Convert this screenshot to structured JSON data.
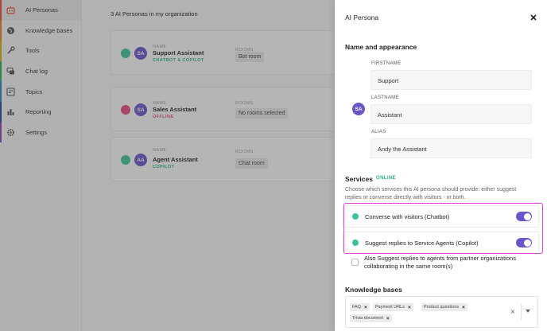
{
  "nav": {
    "items": [
      {
        "label": "AI Personas",
        "icon": "robot-icon",
        "bar_color": "#e74c3c",
        "active": true
      },
      {
        "label": "Knowledge bases",
        "icon": "globe-icon",
        "bar_color": "#e67e22",
        "active": false
      },
      {
        "label": "Tools",
        "icon": "wrench-icon",
        "bar_color": "#d4b000",
        "active": false
      },
      {
        "label": "Chat log",
        "icon": "chat-icon",
        "bar_color": "#27ae60",
        "active": false
      },
      {
        "label": "Topics",
        "icon": "topics-icon",
        "bar_color": "#2980b9",
        "active": false
      },
      {
        "label": "Reporting",
        "icon": "bar-chart-icon",
        "bar_color": "#2c3e9e",
        "active": false
      },
      {
        "label": "Settings",
        "icon": "gear-icon",
        "bar_color": "#8e44ad",
        "active": false
      }
    ]
  },
  "main": {
    "title": "3 AI Personas in my organization",
    "name_label": "NAME",
    "rooms_label": "ROOMS",
    "agents": [
      {
        "initials": "SA",
        "name": "Support Assistant",
        "mode": "CHATBOT & COPILOT",
        "mode_color": "#2cb38f",
        "status_color": "#3ec29b",
        "room": "Bot room"
      },
      {
        "initials": "SA",
        "name": "Sales Assistant",
        "mode": "OFFLINE",
        "mode_color": "#e0507a",
        "status_color": "#e0507a",
        "room": "No rooms selected"
      },
      {
        "initials": "AA",
        "name": "Agent Assistant",
        "mode": "COPILOT",
        "mode_color": "#2cb38f",
        "status_color": "#3ec29b",
        "room": "Chat room"
      }
    ]
  },
  "panel": {
    "title": "AI Persona",
    "name_section": "Name and appearance",
    "avatar_initials": "SA",
    "firstname_label": "FIRSTNAME",
    "firstname_value": "Support",
    "lastname_label": "LASTNAME",
    "lastname_value": "Assistant",
    "alias_label": "ALIAS",
    "alias_value": "Andy the Assistant",
    "services_title": "Services",
    "services_status": "ONLINE",
    "services_desc": "Choose which services this AI persona should provide: either suggest replies or converse directly with visitors - or both.",
    "services": [
      {
        "label": "Converse with visitors (Chatbot)",
        "enabled": true
      },
      {
        "label": "Suggest replies to Service Agents (Copilot)",
        "enabled": true
      }
    ],
    "partner_option": "Also Suggest replies to agents from partner organizations collaborating in the same room(s)",
    "kb_title": "Knowledge bases",
    "kb_tags": [
      "FAQ",
      "Payment URLs",
      "Product questions",
      "Trivia document"
    ]
  },
  "colors": {
    "accent": "#6b55c8",
    "online": "#2cb38f",
    "highlight": "#e040d8"
  }
}
